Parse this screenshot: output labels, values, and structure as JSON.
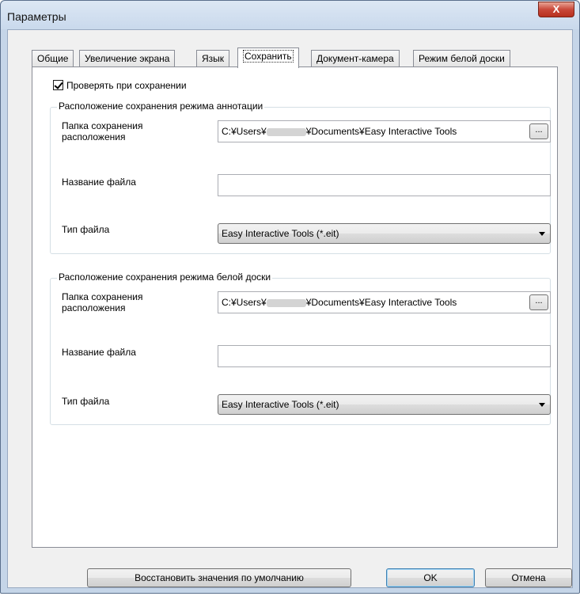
{
  "window": {
    "title": "Параметры",
    "close_label": "X"
  },
  "tabs": [
    {
      "label": "Общие"
    },
    {
      "label": "Увеличение экрана"
    },
    {
      "label": "Язык"
    },
    {
      "label": "Сохранить",
      "active": true
    },
    {
      "label": "Документ-камера"
    },
    {
      "label": "Режим белой доски"
    }
  ],
  "check_on_save": {
    "label": "Проверять при сохранении",
    "checked": true
  },
  "annotation_group": {
    "title": "Расположение сохранения режима аннотации",
    "folder_label_line1": "Папка сохранения",
    "folder_label_line2": "расположения",
    "path_prefix": "C:¥Users¥",
    "path_suffix": "¥Documents¥Easy Interactive Tools",
    "browse_label": "...",
    "filename_label": "Название файла",
    "filename_value": "",
    "filetype_label": "Тип файла",
    "filetype_value": "Easy Interactive Tools (*.eit)"
  },
  "whiteboard_group": {
    "title": "Расположение сохранения режима белой доски",
    "folder_label_line1": "Папка сохранения",
    "folder_label_line2": "расположения",
    "path_prefix": "C:¥Users¥",
    "path_suffix": "¥Documents¥Easy Interactive Tools",
    "browse_label": "...",
    "filename_label": "Название файла",
    "filename_value": "",
    "filetype_label": "Тип файла",
    "filetype_value": "Easy Interactive Tools (*.eit)"
  },
  "buttons": {
    "restore_defaults": "Восстановить значения по умолчанию",
    "ok": "OK",
    "cancel": "Отмена"
  }
}
